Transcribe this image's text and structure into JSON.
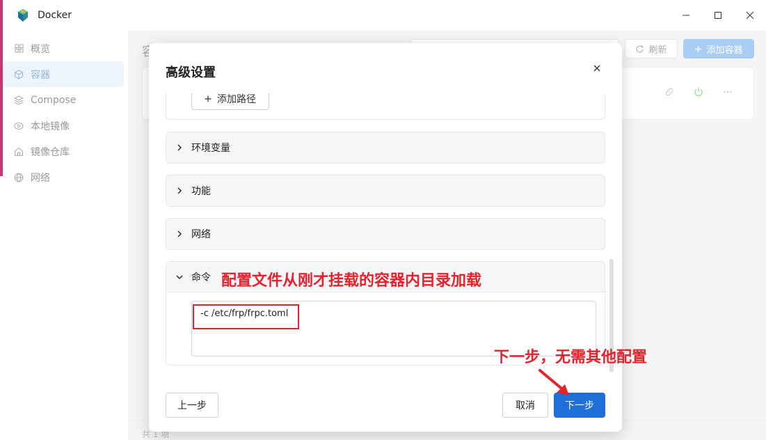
{
  "window": {
    "title": "Docker"
  },
  "sidebar": {
    "items": [
      {
        "label": "概览",
        "icon": "grid-icon"
      },
      {
        "label": "容器",
        "icon": "cube-icon"
      },
      {
        "label": "Compose",
        "icon": "layers-icon"
      },
      {
        "label": "本地镜像",
        "icon": "disc-icon"
      },
      {
        "label": "镜像仓库",
        "icon": "home-icon"
      },
      {
        "label": "网络",
        "icon": "globe-icon"
      }
    ]
  },
  "main": {
    "title": "容",
    "refresh_label": "刷新",
    "add_container_label": "添加容器",
    "footer_text": "共 1 项"
  },
  "modal": {
    "title": "高级设置",
    "add_path_label": "添加路径",
    "sections": [
      {
        "label": "环境变量",
        "expanded": false
      },
      {
        "label": "功能",
        "expanded": false
      },
      {
        "label": "网络",
        "expanded": false
      },
      {
        "label": "命令",
        "expanded": true
      }
    ],
    "command_value": "-c /etc/frp/frpc.toml",
    "prev_label": "上一步",
    "cancel_label": "取消",
    "next_label": "下一步"
  },
  "annotations": {
    "command_note": "配置文件从刚才挂载的容器内目录加载",
    "next_note": "下一步，无需其他配置",
    "color": "#e8222c"
  },
  "colors": {
    "primary": "#1f6fd8",
    "primary_disabled": "#a9cdf5",
    "sidebar_active_bg": "#eef4fb"
  }
}
